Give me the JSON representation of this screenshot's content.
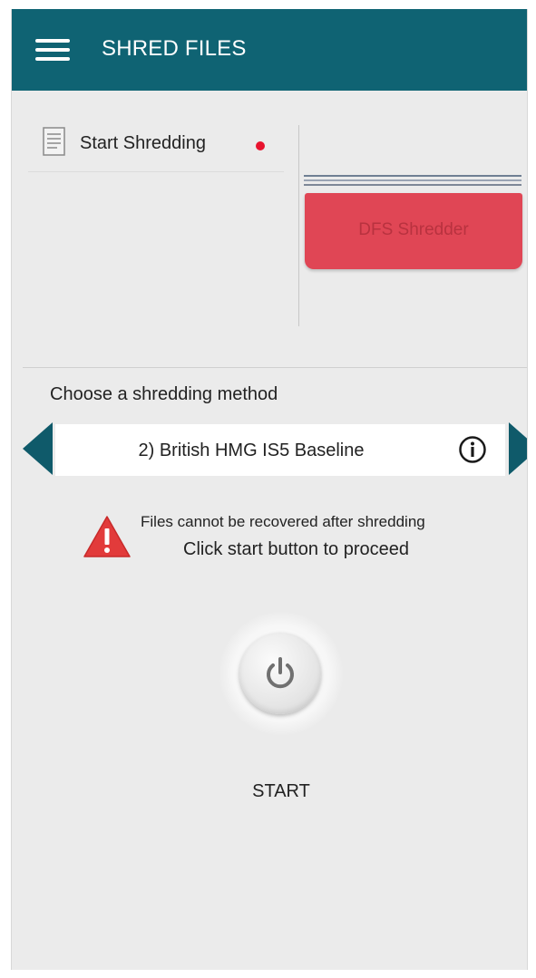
{
  "appbar": {
    "title": "SHRED FILES",
    "menu_icon": "hamburger-menu-icon",
    "color": "#0f6373"
  },
  "status": {
    "start_label": "Start Shredding",
    "indicator_color": "#e8132e",
    "doc_icon": "document-icon"
  },
  "shredder": {
    "label": "DFS Shredder",
    "color": "#e04655"
  },
  "method": {
    "heading": "Choose a shredding method",
    "selected": "2) British HMG IS5 Baseline",
    "prev_icon": "arrow-left-icon",
    "next_icon": "arrow-right-icon",
    "info_icon": "info-icon"
  },
  "warning": {
    "icon": "warning-triangle-icon",
    "line1": "Files cannot be recovered after shredding",
    "line2": "Click start button to proceed"
  },
  "action": {
    "label": "START",
    "icon": "power-icon"
  }
}
